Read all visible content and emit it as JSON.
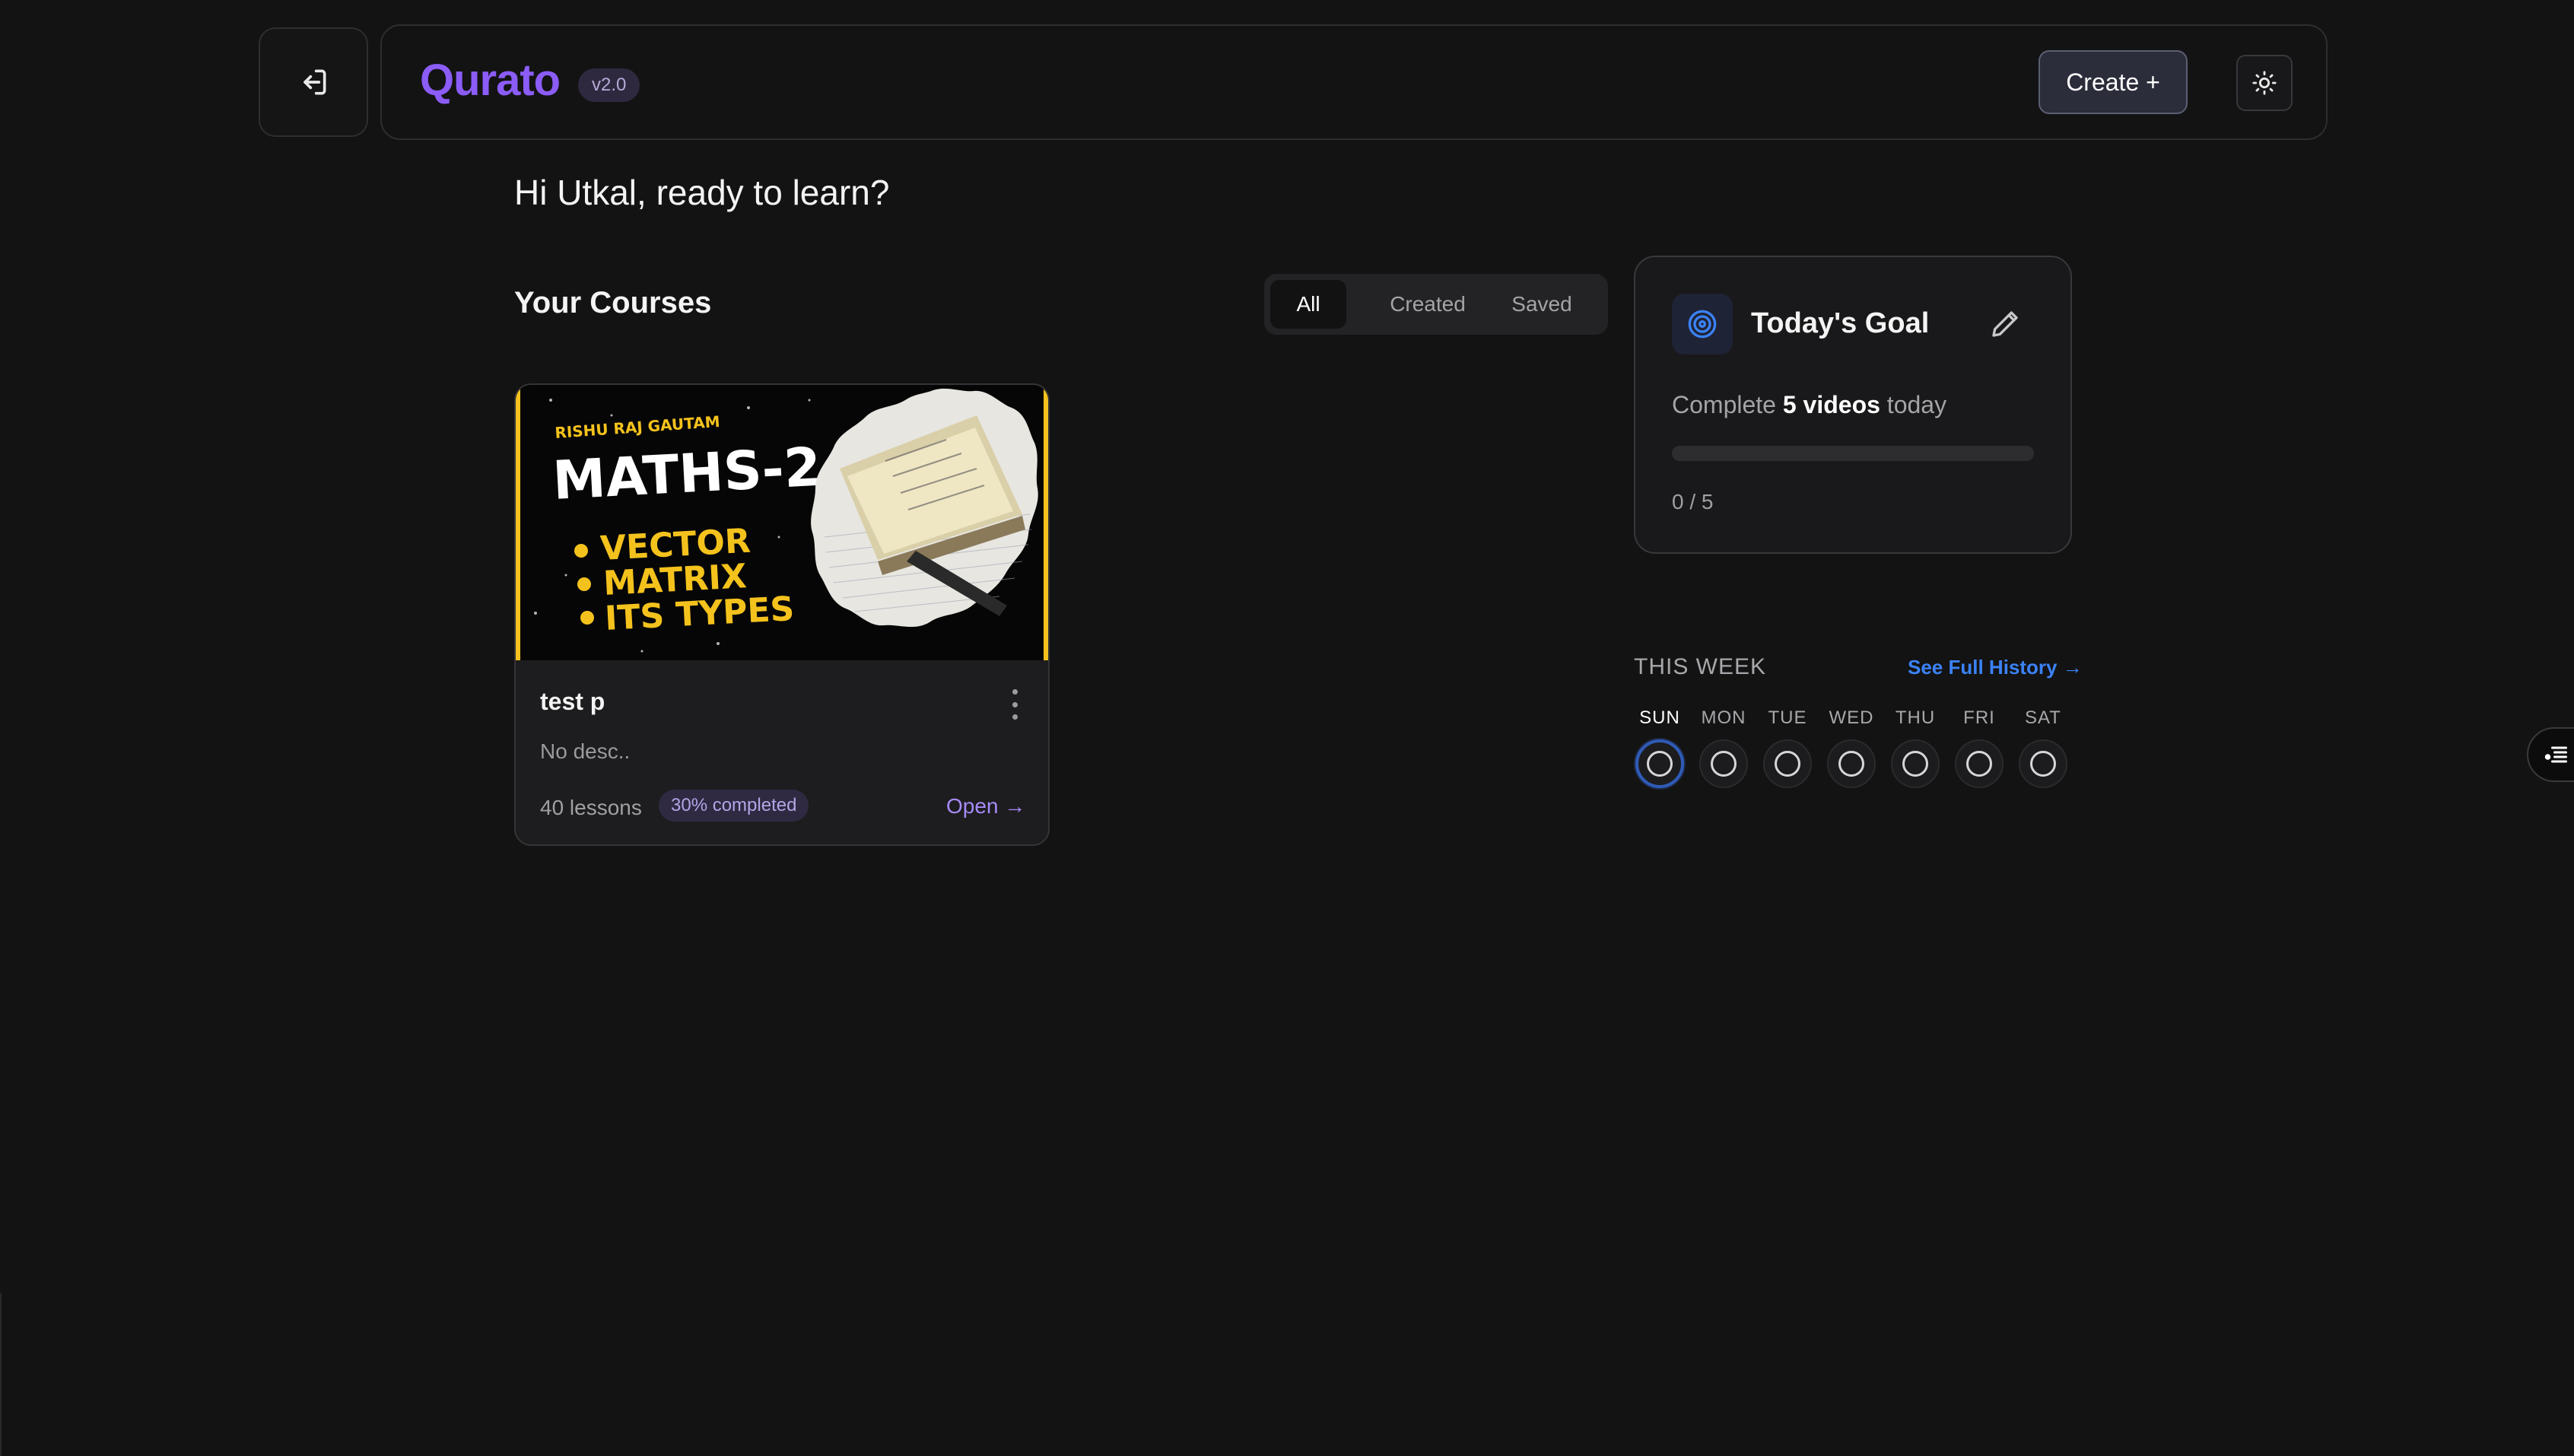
{
  "header": {
    "brand": "Qurato",
    "version": "v2.0",
    "create_label": "Create +"
  },
  "greeting": "Hi Utkal, ready to learn?",
  "courses": {
    "section_title": "Your Courses",
    "tabs": [
      {
        "label": "All",
        "active": true
      },
      {
        "label": "Created",
        "active": false
      },
      {
        "label": "Saved",
        "active": false
      }
    ],
    "items": [
      {
        "title": "test p",
        "description": "No desc..",
        "lessons": "40 lessons",
        "progress_badge": "30% completed",
        "open_label": "Open →",
        "thumbnail": {
          "author": "RISHU RAJ GAUTAM",
          "headline": "MATHS-2",
          "bullets": [
            "VECTOR",
            "MATRIX",
            "ITS TYPES"
          ]
        }
      }
    ]
  },
  "goal": {
    "title": "Today's Goal",
    "text_prefix": "Complete ",
    "text_bold": "5 videos",
    "text_suffix": " today",
    "progress_fraction": 0,
    "count": "0 / 5"
  },
  "week": {
    "title": "THIS WEEK",
    "history_link": "See Full History →",
    "days": [
      {
        "label": "SUN",
        "today": true
      },
      {
        "label": "MON",
        "today": false
      },
      {
        "label": "TUE",
        "today": false
      },
      {
        "label": "WED",
        "today": false
      },
      {
        "label": "THU",
        "today": false
      },
      {
        "label": "FRI",
        "today": false
      },
      {
        "label": "SAT",
        "today": false
      }
    ]
  },
  "colors": {
    "brand": "#8b5cf6",
    "accent_blue": "#3b82f6",
    "thumbnail_yellow": "#f4c21c"
  },
  "icons": [
    "exit-icon",
    "sun-icon",
    "target-icon",
    "pencil-icon",
    "kebab-icon",
    "list-icon"
  ]
}
